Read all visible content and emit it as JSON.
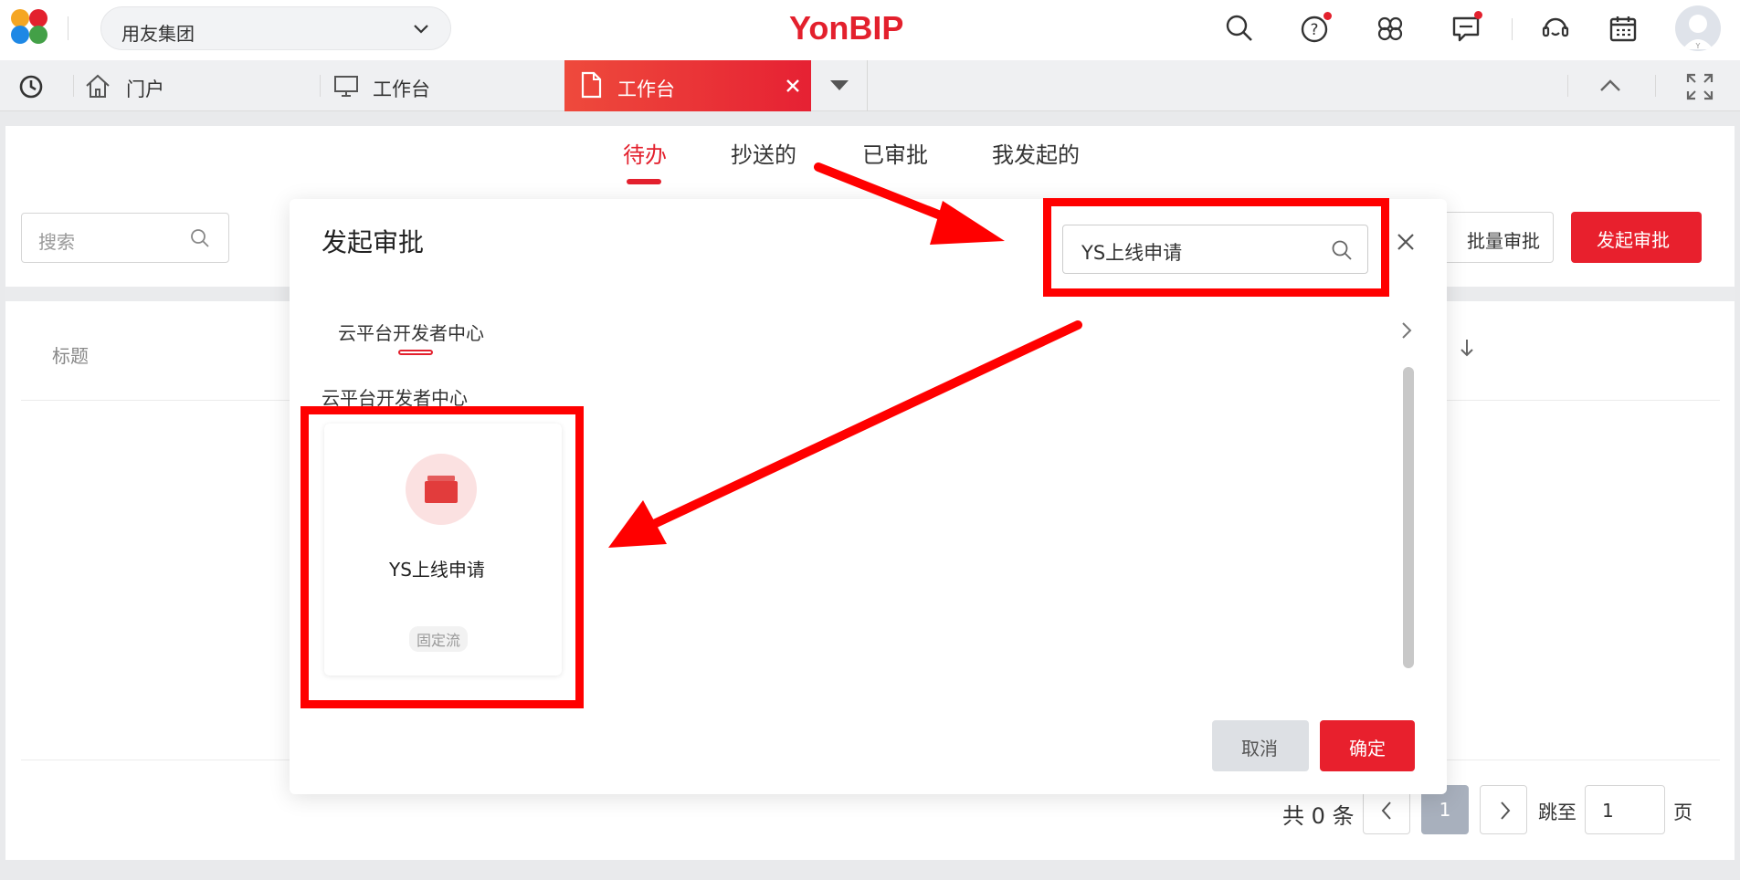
{
  "header": {
    "org_name": "用友集团",
    "brand": "YonBIP",
    "icons": [
      "search-icon",
      "help-icon",
      "apps-icon",
      "message-icon",
      "service-icon",
      "calendar-icon",
      "avatar"
    ]
  },
  "tabbar": {
    "tabs": [
      {
        "label": "门户",
        "icon": "home-icon"
      },
      {
        "label": "工作台",
        "icon": "monitor-icon"
      },
      {
        "label": "工作台",
        "icon": "document-icon",
        "active": true
      }
    ]
  },
  "main": {
    "tabs": [
      "待办",
      "抄送的",
      "已审批",
      "我发起的"
    ],
    "active_tab": "待办",
    "search_placeholder": "搜索",
    "batch_button": "批量审批",
    "start_button": "发起审批",
    "column_title": "标题"
  },
  "pager": {
    "total_text": "共 0 条",
    "current_page": "1",
    "jump_label": "跳至",
    "jump_value": "1",
    "page_label": "页"
  },
  "modal": {
    "title": "发起审批",
    "search_value": "YS上线申请",
    "category_tab": "云平台开发者中心",
    "category_heading": "云平台开发者中心",
    "card": {
      "name": "YS上线申请",
      "tag": "固定流"
    },
    "cancel": "取消",
    "ok": "确定"
  },
  "colors": {
    "accent": "#e3202d",
    "annotation": "#ff0000"
  }
}
